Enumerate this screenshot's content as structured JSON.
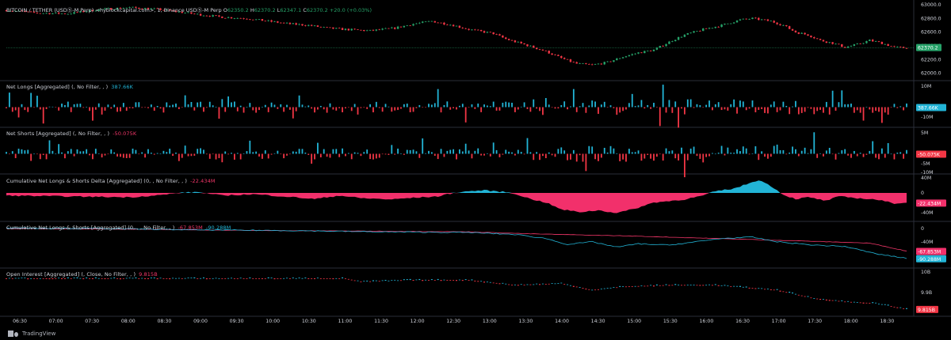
{
  "header": {
    "symbol": "BITCOIN / TETHER (USDⓈ-M Perp) <hyblockcapital.com>, 1, Binance USDⓈ-M Perp",
    "open_label": "O",
    "open": "62350.2",
    "high_label": "H",
    "high": "62370.2",
    "low_label": "L",
    "low": "62347.1",
    "close_label": "C",
    "close": "62370.2",
    "change": "+20.0 (+0.03%)"
  },
  "panes": {
    "net_longs": {
      "title": "Net Longs [Aggregated] (, No Filter, , )",
      "value": "387.66K",
      "badge": "387.66K"
    },
    "net_shorts": {
      "title": "Net Shorts [Aggregated] (, No Filter, , )",
      "value": "-50.075K",
      "badge": "-50.075K"
    },
    "delta": {
      "title": "Cumulative Net Longs & Shorts Delta [Aggregated] (0, , No Filter, , )",
      "value": "-22.434M",
      "badge": "-22.434M"
    },
    "cumulative": {
      "title": "Cumulative Net Longs & Shorts [Aggregated] (0, , , No Filter, , )",
      "value1": "-67.853M",
      "value2": "-90.288M",
      "badge1": "-67.853M",
      "badge2": "-90.288M"
    },
    "open_interest": {
      "title": "Open Interest [Aggregated] (, Close, No Filter, , )",
      "value": "9.815B",
      "badge": "9.815B"
    }
  },
  "price_badge": "62370.2",
  "brand": "TradingView",
  "colors": {
    "up": "#26a269",
    "down": "#f23645",
    "cyan": "#22b4d6",
    "pink": "#f2306b",
    "bg": "#000000",
    "grid": "#1a1a1a"
  },
  "chart_data": [
    {
      "type": "candlestick",
      "title": "BITCOIN / TETHER (USDⓈ-M Perp) <hyblockcapital.com>, 1, Binance USDⓈ-M Perp",
      "x_ticks": [
        "06:30",
        "07:00",
        "07:30",
        "08:00",
        "08:30",
        "09:00",
        "09:30",
        "10:00",
        "10:30",
        "11:00",
        "11:30",
        "12:00",
        "12:30",
        "13:00",
        "13:30",
        "14:00",
        "14:30",
        "15:00",
        "15:30",
        "16:00",
        "16:30",
        "17:00",
        "17:30",
        "18:00",
        "18:30"
      ],
      "y_ticks": [
        62000.0,
        62200.0,
        62400.0,
        62600.0,
        62800.0,
        63000.0
      ],
      "ylim": [
        61950,
        63000
      ],
      "last_price": 62370.2,
      "price_path": [
        [
          0,
          62920
        ],
        [
          10,
          62880
        ],
        [
          20,
          62870
        ],
        [
          30,
          62930
        ],
        [
          40,
          62960
        ],
        [
          50,
          62930
        ],
        [
          55,
          62900
        ],
        [
          62,
          62860
        ],
        [
          70,
          62820
        ],
        [
          78,
          62800
        ],
        [
          85,
          62760
        ],
        [
          92,
          62720
        ],
        [
          98,
          62700
        ],
        [
          104,
          62660
        ],
        [
          110,
          62640
        ],
        [
          118,
          62620
        ],
        [
          126,
          62660
        ],
        [
          132,
          62720
        ],
        [
          138,
          62760
        ],
        [
          145,
          62700
        ],
        [
          150,
          62640
        ],
        [
          158,
          62580
        ],
        [
          162,
          62500
        ],
        [
          168,
          62420
        ],
        [
          175,
          62320
        ],
        [
          180,
          62220
        ],
        [
          185,
          62140
        ],
        [
          190,
          62120
        ],
        [
          195,
          62160
        ],
        [
          200,
          62240
        ],
        [
          205,
          62300
        ],
        [
          210,
          62340
        ],
        [
          216,
          62480
        ],
        [
          220,
          62560
        ],
        [
          226,
          62640
        ],
        [
          232,
          62700
        ],
        [
          238,
          62780
        ],
        [
          242,
          62800
        ],
        [
          248,
          62760
        ],
        [
          252,
          62700
        ],
        [
          256,
          62600
        ],
        [
          260,
          62560
        ],
        [
          264,
          62480
        ],
        [
          268,
          62440
        ],
        [
          272,
          62380
        ],
        [
          276,
          62420
        ],
        [
          280,
          62480
        ],
        [
          284,
          62440
        ],
        [
          288,
          62380
        ],
        [
          292,
          62370
        ]
      ]
    },
    {
      "type": "bar",
      "title": "Net Longs [Aggregated] (, No Filter, , )",
      "y_ticks": [
        "10M",
        "-10M"
      ],
      "last_value": "387.66K"
    },
    {
      "type": "bar",
      "title": "Net Shorts [Aggregated] (, No Filter, , )",
      "y_ticks": [
        "5M",
        "-5M",
        "-10M"
      ],
      "last_value": "-50.075K"
    },
    {
      "type": "area",
      "title": "Cumulative Net Longs & Shorts Delta [Aggregated] (0, , No Filter, , )",
      "y_ticks": [
        "40M",
        "0",
        "-40M"
      ],
      "ylim": [
        -45,
        45
      ],
      "last_value": "-22.434M",
      "path": [
        [
          0,
          -6
        ],
        [
          20,
          -8
        ],
        [
          40,
          -10
        ],
        [
          50,
          -5
        ],
        [
          56,
          0
        ],
        [
          62,
          2
        ],
        [
          70,
          -6
        ],
        [
          80,
          -3
        ],
        [
          90,
          -8
        ],
        [
          100,
          -14
        ],
        [
          108,
          -6
        ],
        [
          115,
          -12
        ],
        [
          125,
          -15
        ],
        [
          130,
          -12
        ],
        [
          140,
          -8
        ],
        [
          145,
          0
        ],
        [
          150,
          4
        ],
        [
          155,
          6
        ],
        [
          162,
          2
        ],
        [
          166,
          -4
        ],
        [
          170,
          -14
        ],
        [
          175,
          -22
        ],
        [
          180,
          -38
        ],
        [
          186,
          -44
        ],
        [
          192,
          -40
        ],
        [
          198,
          -46
        ],
        [
          204,
          -36
        ],
        [
          210,
          -22
        ],
        [
          216,
          -18
        ],
        [
          220,
          -15
        ],
        [
          226,
          -6
        ],
        [
          230,
          4
        ],
        [
          236,
          10
        ],
        [
          240,
          20
        ],
        [
          244,
          30
        ],
        [
          248,
          16
        ],
        [
          252,
          -4
        ],
        [
          256,
          -14
        ],
        [
          260,
          -10
        ],
        [
          266,
          -18
        ],
        [
          270,
          -8
        ],
        [
          276,
          -12
        ],
        [
          282,
          -15
        ],
        [
          288,
          -24
        ],
        [
          292,
          -22
        ]
      ]
    },
    {
      "type": "line",
      "title": "Cumulative Net Longs & Shorts [Aggregated] (0, , , No Filter, , )",
      "y_ticks": [
        "0",
        "-40M",
        "-80M"
      ],
      "ylim": [
        -100,
        10
      ],
      "series": [
        {
          "name": "",
          "color": "#f23669",
          "last_value": "-67.853M",
          "path": [
            [
              0,
              0
            ],
            [
              40,
              -2
            ],
            [
              80,
              -6
            ],
            [
              120,
              -8
            ],
            [
              150,
              -10
            ],
            [
              170,
              -16
            ],
            [
              200,
              -22
            ],
            [
              230,
              -30
            ],
            [
              260,
              -38
            ],
            [
              280,
              -44
            ],
            [
              292,
              -68
            ]
          ]
        },
        {
          "name": "",
          "color": "#22b4d6",
          "last_value": "-90.288M",
          "path": [
            [
              0,
              2
            ],
            [
              30,
              0
            ],
            [
              60,
              -4
            ],
            [
              90,
              -6
            ],
            [
              120,
              -10
            ],
            [
              150,
              -12
            ],
            [
              165,
              -18
            ],
            [
              175,
              -30
            ],
            [
              182,
              -48
            ],
            [
              190,
              -40
            ],
            [
              198,
              -56
            ],
            [
              205,
              -46
            ],
            [
              215,
              -50
            ],
            [
              222,
              -42
            ],
            [
              232,
              -30
            ],
            [
              242,
              -26
            ],
            [
              250,
              -40
            ],
            [
              262,
              -50
            ],
            [
              272,
              -54
            ],
            [
              282,
              -76
            ],
            [
              292,
              -90
            ]
          ]
        }
      ]
    },
    {
      "type": "line",
      "title": "Open Interest [Aggregated] (, Close, No Filter, , )",
      "y_ticks": [
        "10B",
        "9.9B"
      ],
      "last_value": "9.815B",
      "path": [
        [
          0,
          10.0
        ],
        [
          40,
          10.0
        ],
        [
          80,
          10.0
        ],
        [
          110,
          10.0
        ],
        [
          115,
          9.98
        ],
        [
          130,
          9.99
        ],
        [
          150,
          9.99
        ],
        [
          165,
          9.96
        ],
        [
          180,
          9.97
        ],
        [
          190,
          9.93
        ],
        [
          200,
          9.95
        ],
        [
          215,
          9.96
        ],
        [
          230,
          9.96
        ],
        [
          250,
          9.93
        ],
        [
          262,
          9.88
        ],
        [
          272,
          9.86
        ],
        [
          282,
          9.85
        ],
        [
          292,
          9.815
        ]
      ]
    }
  ]
}
